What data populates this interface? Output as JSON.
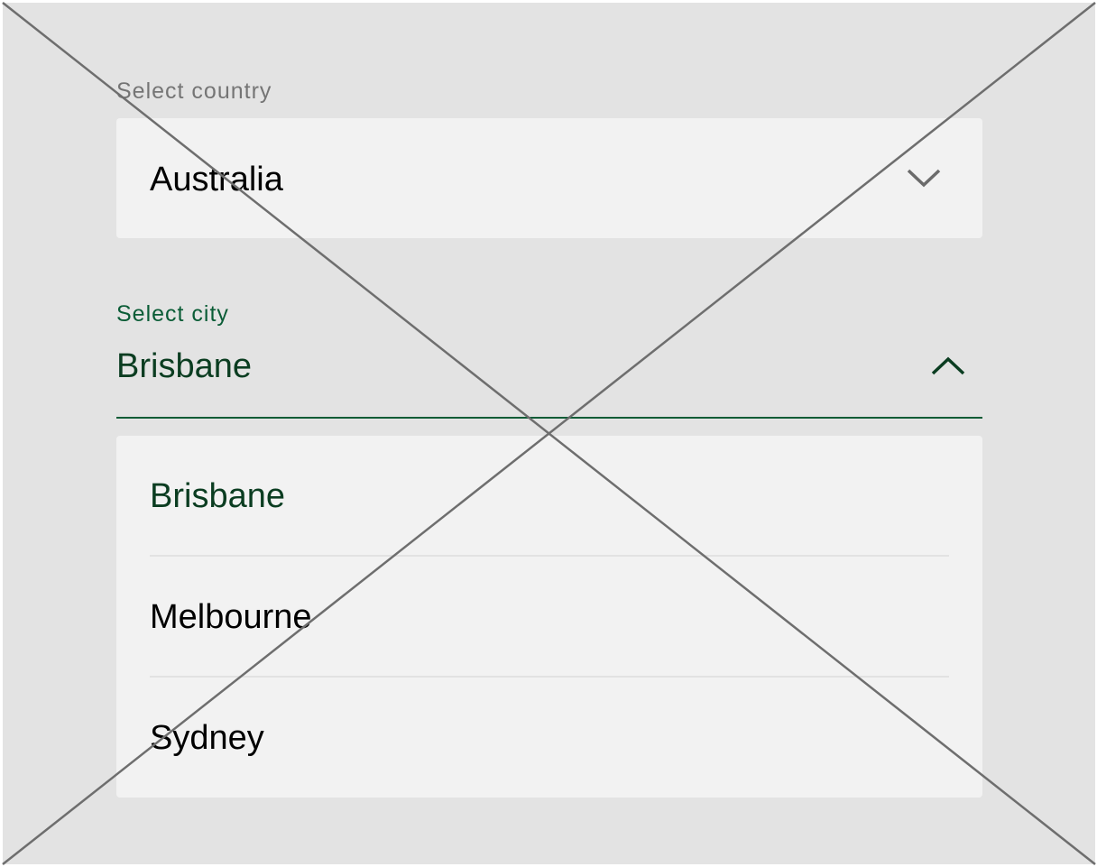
{
  "country": {
    "label": "Select country",
    "value": "Australia",
    "expanded": false,
    "icon": "chevron-down-icon"
  },
  "city": {
    "label": "Select city",
    "value": "Brisbane",
    "expanded": true,
    "icon": "chevron-up-icon",
    "options": [
      {
        "label": "Brisbane",
        "selected": true
      },
      {
        "label": "Melbourne",
        "selected": false
      },
      {
        "label": "Sydney",
        "selected": false
      }
    ]
  },
  "colors": {
    "canvas": "#e3e3e3",
    "field": "#f2f2f2",
    "accent": "#0a5c36",
    "accent_text": "#0b3d21",
    "muted_label": "#757575",
    "placeholder_cross": "#6e6e6e"
  }
}
